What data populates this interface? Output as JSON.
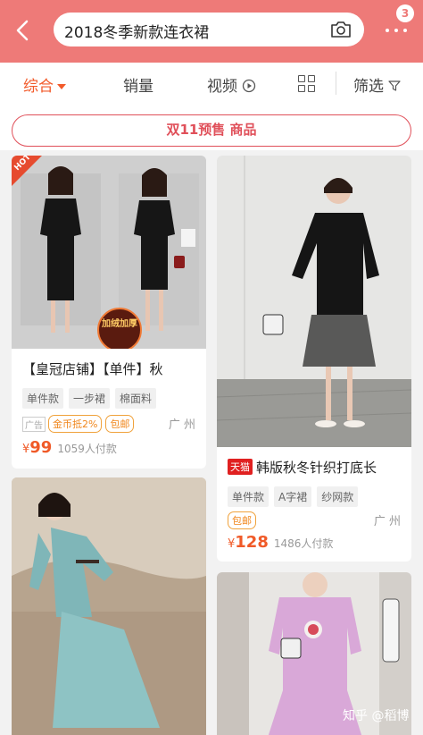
{
  "header": {
    "search_query": "2018冬季新款连衣裙",
    "badge_count": "3",
    "colors": {
      "header_bg": "#ee7a78",
      "accent": "#f25a2a",
      "price": "#f05a28"
    },
    "icons": [
      "chevron-left-icon",
      "camera-icon",
      "more-dots-icon"
    ]
  },
  "sortbar": {
    "tabs": [
      {
        "label": "综合",
        "active": true
      },
      {
        "label": "销量"
      },
      {
        "label": "视频"
      },
      {
        "label": "筛选"
      }
    ]
  },
  "promo": {
    "label": "双11预售 商品"
  },
  "products": [
    {
      "corner_badge": "HOT",
      "overlay_badge": "加绒加厚",
      "title": "【皇冠店铺】【单件】秋",
      "tags": [
        "单件款",
        "一步裙",
        "棉面料"
      ],
      "ad_label": "广告",
      "promo_tags": [
        "金币抵2%",
        "包邮"
      ],
      "location": "广 州",
      "currency": "¥",
      "price": "99",
      "sales": "1059人付款"
    },
    {
      "shop_tag": "天猫",
      "title": "韩版秋冬针织打底长",
      "tags": [
        "单件款",
        "A字裙",
        "纱网款"
      ],
      "promo_tags": [
        "包邮"
      ],
      "location": "广 州",
      "currency": "¥",
      "price": "128",
      "sales": "1486人付款"
    }
  ],
  "watermark": "知乎 @稻博"
}
